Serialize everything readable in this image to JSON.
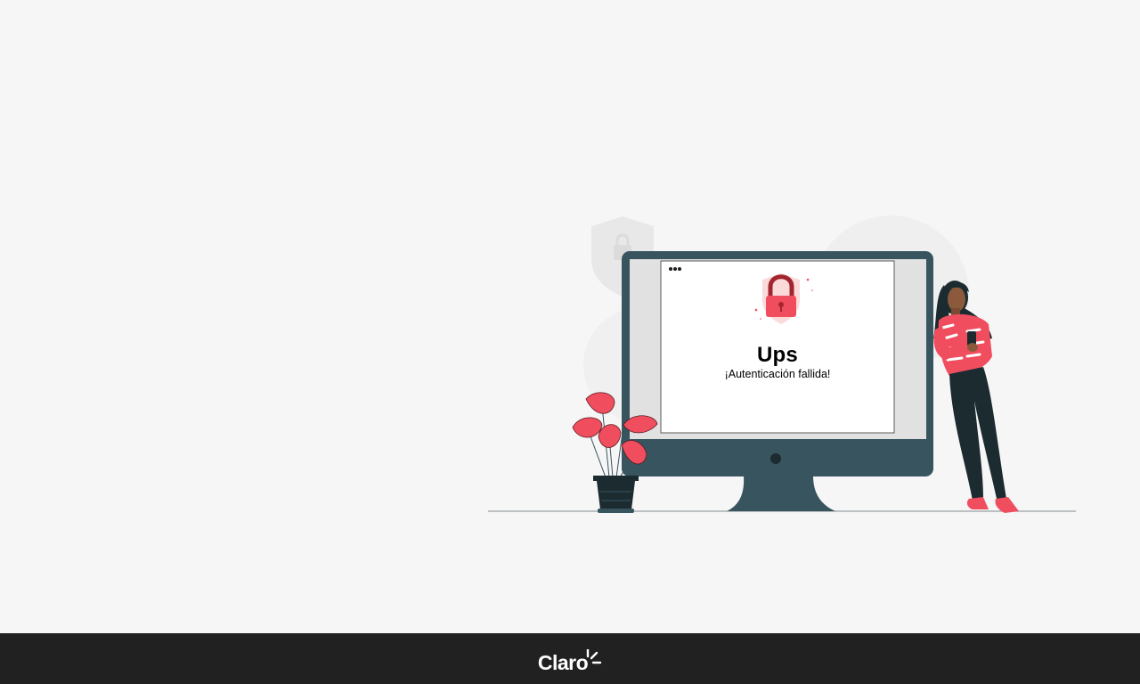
{
  "message": {
    "title": "Ups",
    "subtitle": "¡Autenticación fallida!"
  },
  "footer": {
    "logo_text": "Claro"
  },
  "icons": {
    "lock": "lock-icon",
    "shield": "shield-icon",
    "window_dots": "window-dots-icon"
  },
  "colors": {
    "background": "#f6f6f6",
    "footer": "#212121",
    "monitor": "#37545f",
    "accent": "#f04e5e",
    "lock_dark": "#a2262f"
  }
}
